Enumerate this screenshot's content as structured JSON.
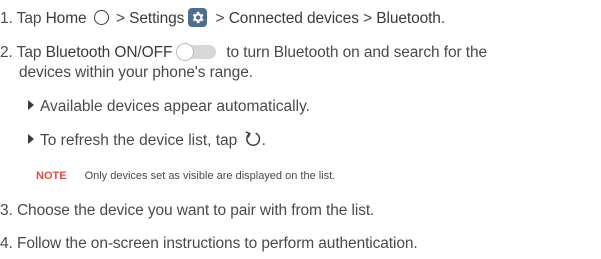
{
  "steps": {
    "s1": {
      "num": "1.",
      "t1": "Tap ",
      "home": "Home",
      "t2": " > ",
      "settings": "Settings",
      "t3": " > ",
      "connected": "Connected devices",
      "t4": " > ",
      "bluetooth": "Bluetooth",
      "t5": "."
    },
    "s2": {
      "num": "2.",
      "t1": "Tap ",
      "toggle_label": "Bluetooth ON/OFF",
      "t2": "to turn Bluetooth on and search for the",
      "cont": "devices within your phone's range."
    },
    "bullets": [
      "Available devices appear automatically.",
      "To refresh the device list, tap "
    ],
    "bullet_end": ".",
    "note": {
      "label": "NOTE",
      "text": "Only devices set as visible are displayed on the list."
    },
    "s3": {
      "num": "3.",
      "text": "Choose the device you want to pair with from the list."
    },
    "s4": {
      "num": "4.",
      "text": "Follow the on-screen instructions to perform authentication."
    }
  },
  "icons": {
    "home": "home-circle-icon",
    "settings": "gear-icon",
    "toggle": "toggle-off-icon",
    "refresh": "refresh-icon"
  },
  "colors": {
    "text": "#4a4a4a",
    "note_label": "#e84c3d",
    "settings_bg": "#4d6e8f",
    "toggle_track": "#d8d8d8"
  }
}
